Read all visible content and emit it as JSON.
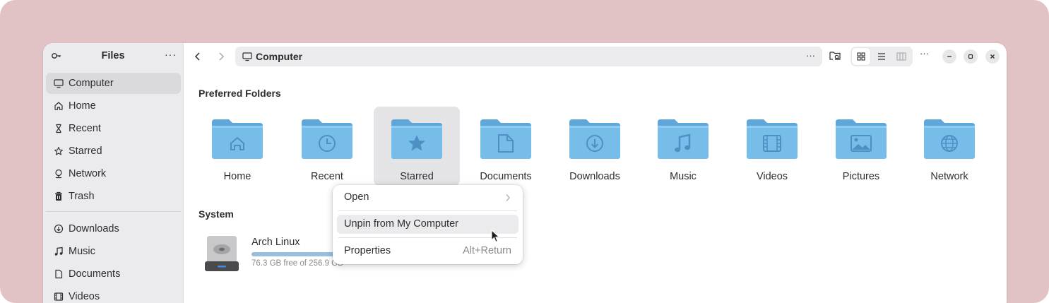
{
  "sidebar": {
    "title": "Files",
    "places": [
      {
        "label": "Computer",
        "icon": "computer-icon",
        "active": true
      },
      {
        "label": "Home",
        "icon": "home-icon"
      },
      {
        "label": "Recent",
        "icon": "recent-icon"
      },
      {
        "label": "Starred",
        "icon": "star-icon"
      },
      {
        "label": "Network",
        "icon": "network-icon"
      },
      {
        "label": "Trash",
        "icon": "trash-icon"
      }
    ],
    "bookmarks": [
      {
        "label": "Downloads",
        "icon": "downloads-icon"
      },
      {
        "label": "Music",
        "icon": "music-icon"
      },
      {
        "label": "Documents",
        "icon": "documents-icon"
      },
      {
        "label": "Videos",
        "icon": "videos-icon"
      }
    ]
  },
  "header": {
    "location": "Computer"
  },
  "main": {
    "preferred_title": "Preferred Folders",
    "folders": [
      {
        "label": "Home",
        "icon": "home-folder-icon"
      },
      {
        "label": "Recent",
        "icon": "recent-folder-icon"
      },
      {
        "label": "Starred",
        "icon": "starred-folder-icon",
        "selected": true
      },
      {
        "label": "Documents",
        "icon": "documents-folder-icon"
      },
      {
        "label": "Downloads",
        "icon": "downloads-folder-icon"
      },
      {
        "label": "Music",
        "icon": "music-folder-icon"
      },
      {
        "label": "Videos",
        "icon": "videos-folder-icon"
      },
      {
        "label": "Pictures",
        "icon": "pictures-folder-icon"
      },
      {
        "label": "Network",
        "icon": "network-folder-icon"
      }
    ],
    "system_title": "System",
    "drive": {
      "name": "Arch Linux",
      "free_text": "76.3 GB free of 256.9 GB",
      "used_fraction": 0.703
    }
  },
  "context_menu": {
    "open": "Open",
    "unpin": "Unpin from My Computer",
    "properties": "Properties",
    "properties_accel": "Alt+Return"
  },
  "colors": {
    "backdrop": "#e2c3c5",
    "folder": "#6db3e3",
    "accent": "#3584e4"
  }
}
